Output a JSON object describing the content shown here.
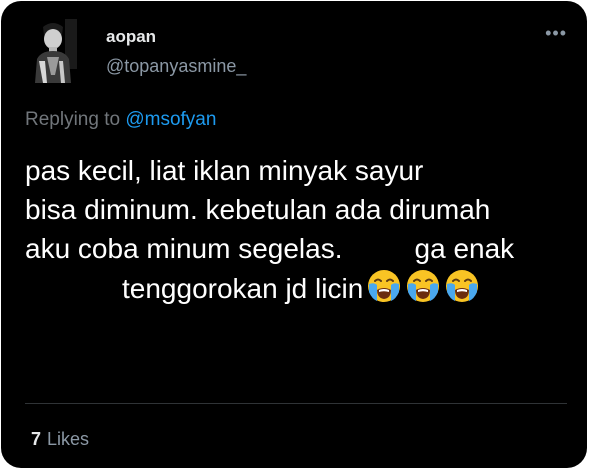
{
  "author": {
    "name": "aopan",
    "handle": "@topanyasmine_",
    "avatar_icon": "person-avatar"
  },
  "menu": {
    "icon": "more-options-icon",
    "glyph": "•••"
  },
  "reply": {
    "prefix": "Replying to",
    "mention": "@msofyan"
  },
  "tweet": {
    "line1": "pas kecil, liat iklan minyak sayur",
    "line2": "bisa diminum. kebetulan ada dirumah",
    "line3a": "aku coba minum segelas.",
    "line3b": "ga enak",
    "line4": "tenggorokan jd licin",
    "emoji": "loudly-crying-face-emoji",
    "emoji_count": 3
  },
  "stats": {
    "likes_count": "7",
    "likes_label": "Likes"
  },
  "colors": {
    "background": "#000000",
    "text": "#ffffff",
    "secondary": "#8b98a5",
    "link": "#1d9bf0",
    "divider": "#2f3336",
    "emoji_face": "#f9c424",
    "emoji_tears": "#4aa8ee"
  }
}
